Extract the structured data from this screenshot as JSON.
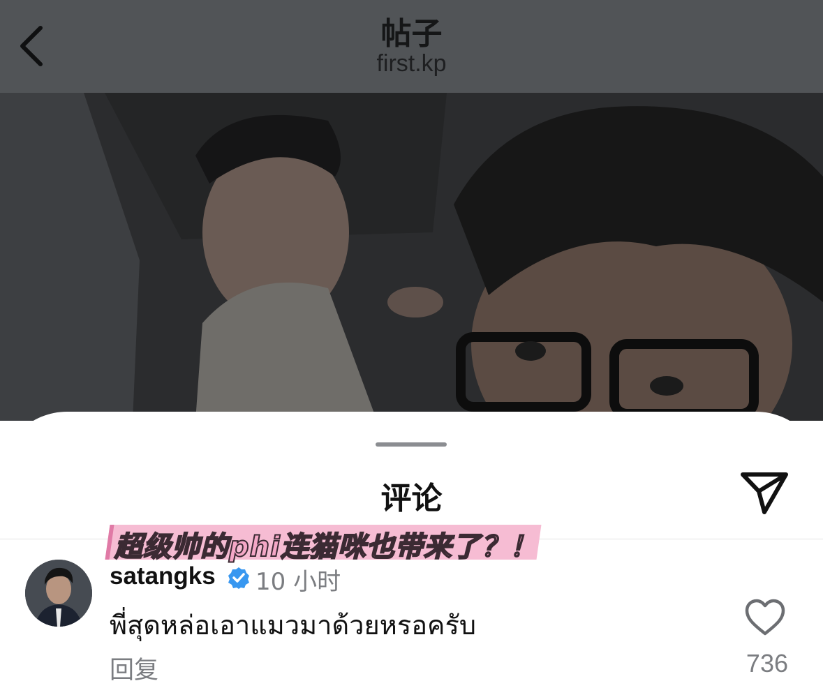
{
  "header": {
    "title": "帖子",
    "subtitle": "first.kp"
  },
  "sheet": {
    "title": "评论"
  },
  "caption": {
    "text": "超级帅的phi连猫咪也带来了？！"
  },
  "comment": {
    "username": "satangks",
    "time": "10 小时",
    "text": "พี่สุดหล่อเอาแมวมาด้วยหรอครับ",
    "reply_label": "回复",
    "likes": "736",
    "verified": true
  },
  "colors": {
    "header_bg": "#515457",
    "verified_blue": "#3897f0",
    "caption_pink": "#f6bcd3",
    "muted_text": "#7b7d81"
  },
  "icons": {
    "back": "chevron-left-icon",
    "share": "paper-plane-icon",
    "like": "heart-outline-icon",
    "verified": "verified-badge-icon"
  }
}
